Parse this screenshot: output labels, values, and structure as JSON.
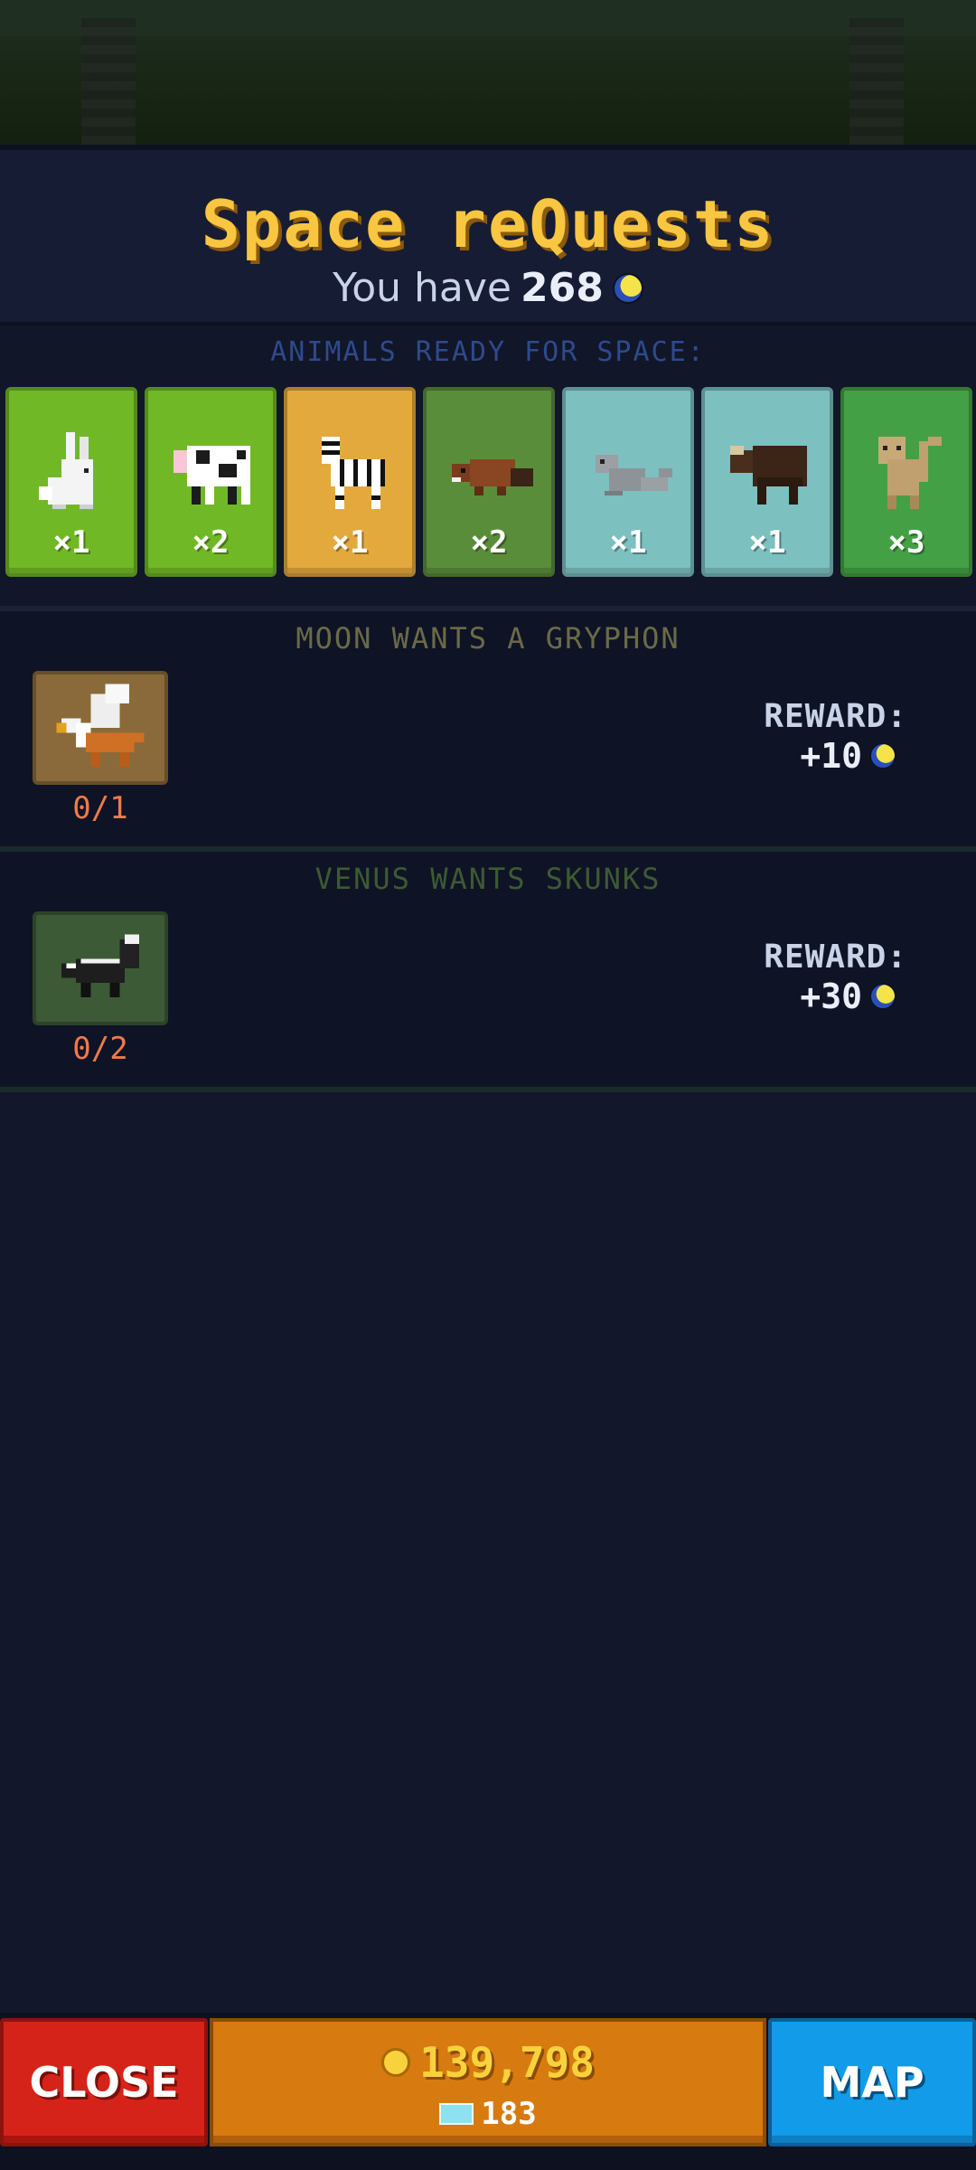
{
  "header": {
    "title": "Space reQuests",
    "subtitle_prefix": "You have",
    "moon_balance": "268",
    "currency_icon": "moon-token-icon"
  },
  "animals_section": {
    "label": "ANIMALS READY FOR SPACE:",
    "cards": [
      {
        "animal": "rabbit",
        "icon": "rabbit-icon",
        "count": "×1",
        "color": "#71b826"
      },
      {
        "animal": "cow",
        "icon": "cow-icon",
        "count": "×2",
        "color": "#71b826"
      },
      {
        "animal": "zebra",
        "icon": "zebra-icon",
        "count": "×1",
        "color": "#e3a93c"
      },
      {
        "animal": "beaver",
        "icon": "beaver-icon",
        "count": "×2",
        "color": "#5a8d3a"
      },
      {
        "animal": "seal",
        "icon": "seal-icon",
        "count": "×1",
        "color": "#7cc0c0"
      },
      {
        "animal": "musk ox",
        "icon": "musk-ox-icon",
        "count": "×1",
        "color": "#7cc0c0"
      },
      {
        "animal": "monkey",
        "icon": "monkey-icon",
        "count": "×3",
        "color": "#44a044"
      }
    ]
  },
  "requests": [
    {
      "title": "MOON WANTS A GRYPHON",
      "title_color": "#6b6a48",
      "icon": "gryphon-icon",
      "thumb_color": "#8a6a3a",
      "progress": "0/1",
      "reward_label": "REWARD:",
      "reward_value": "+10"
    },
    {
      "title": "VENUS WANTS SKUNKS",
      "title_color": "#3d5a32",
      "icon": "skunk-icon",
      "thumb_color": "#3c5a36",
      "progress": "0/2",
      "reward_label": "REWARD:",
      "reward_value": "+30"
    }
  ],
  "bottom_bar": {
    "close_label": "CLOSE",
    "coins": "139,798",
    "gems": "183",
    "map_label": "MAP"
  }
}
